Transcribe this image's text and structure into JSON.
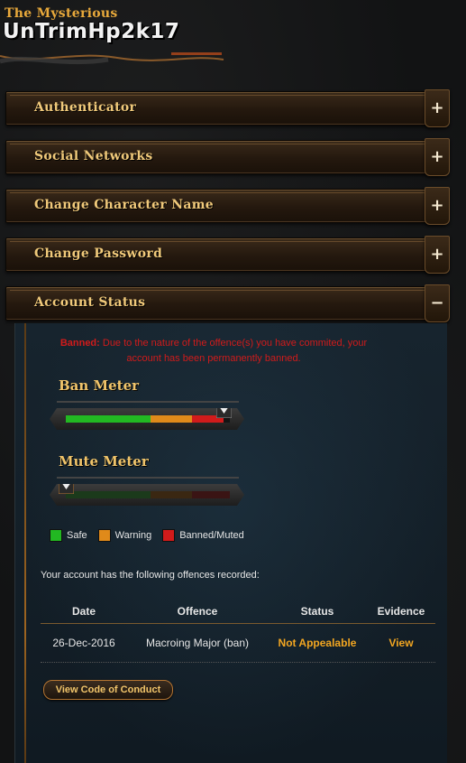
{
  "header": {
    "subtitle": "The Mysterious",
    "player_name": "UnTrimHp2k17"
  },
  "panels": [
    {
      "label": "Authenticator",
      "state": "+"
    },
    {
      "label": "Social Networks",
      "state": "+"
    },
    {
      "label": "Change Character Name",
      "state": "+"
    },
    {
      "label": "Change Password",
      "state": "+"
    },
    {
      "label": "Account Status",
      "state": "−"
    }
  ],
  "account_status": {
    "banned_prefix": "Banned:",
    "banned_text": " Due to the nature of the offence(s) you have commited, your account has been permanently banned.",
    "ban_meter": {
      "title": "Ban Meter",
      "level": 0.96
    },
    "mute_meter": {
      "title": "Mute Meter",
      "level": 0.0
    },
    "legend": [
      {
        "label": "Safe",
        "color": "#22b822"
      },
      {
        "label": "Warning",
        "color": "#e08a1a"
      },
      {
        "label": "Banned/Muted",
        "color": "#d11b1b"
      }
    ],
    "offences_intro": "Your account has the following offences recorded:",
    "table": {
      "headers": [
        "Date",
        "Offence",
        "Status",
        "Evidence"
      ],
      "rows": [
        {
          "date": "26-Dec-2016",
          "offence": "Macroing Major (ban)",
          "status": "Not Appealable",
          "evidence": "View"
        }
      ]
    },
    "conduct_button": "View Code of Conduct"
  },
  "colors": {
    "accent": "#f0c46a",
    "banned": "#d11b1b",
    "status_orange": "#f2a621"
  }
}
